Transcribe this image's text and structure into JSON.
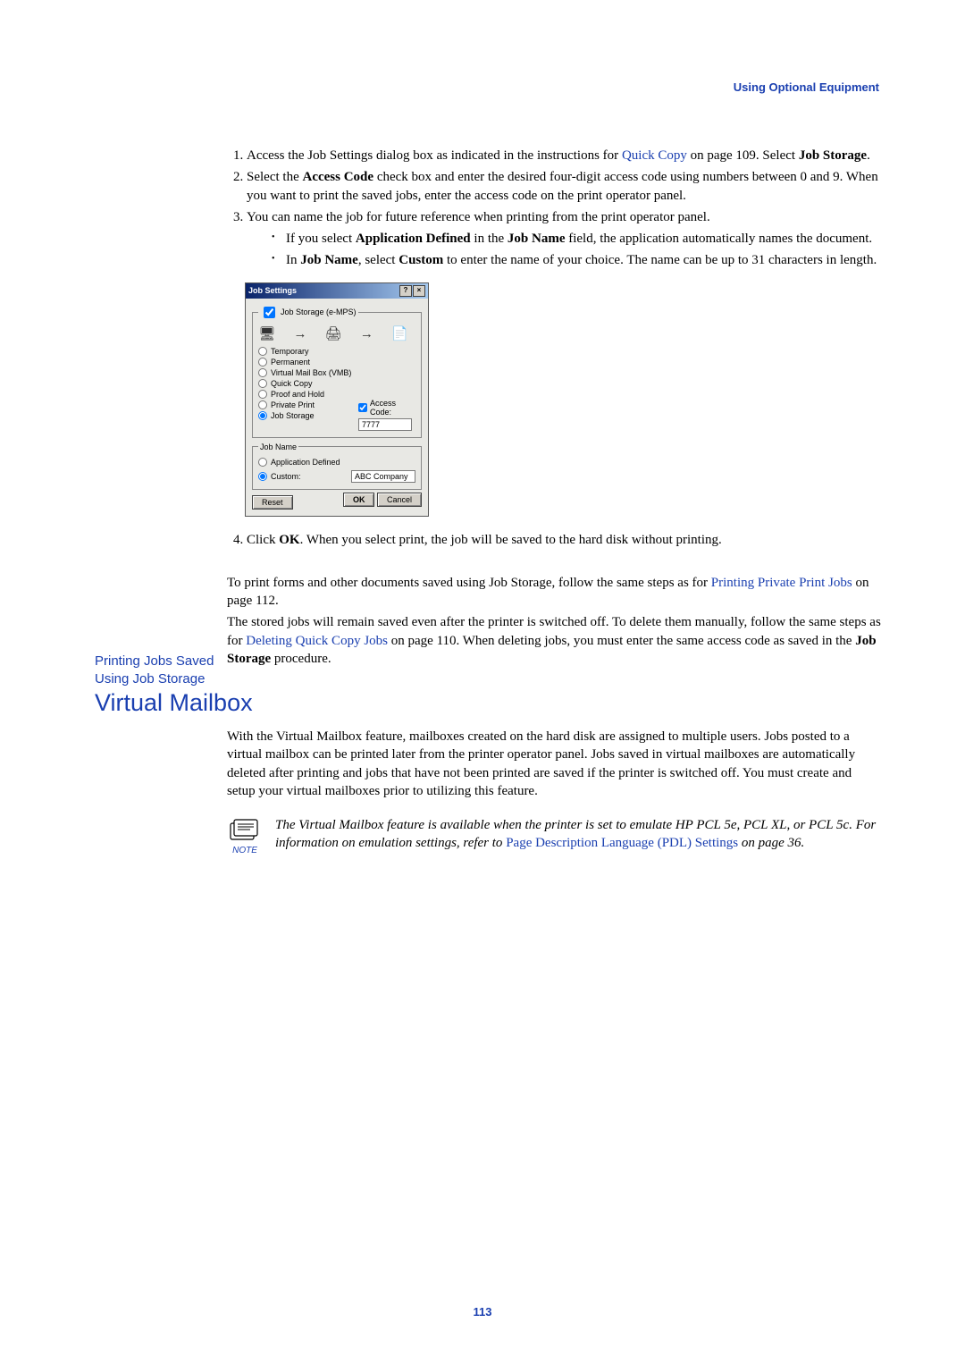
{
  "header": {
    "running": "Using Optional Equipment"
  },
  "steps": {
    "s1a": "Access the Job Settings dialog box as indicated in the instructions for ",
    "s1link": "Quick Copy",
    "s1b": " on page 109. Select ",
    "s1bold": "Job Storage",
    "s1c": ".",
    "s2a": "Select the ",
    "s2bold": "Access Code",
    "s2b": " check box and enter the desired four-digit access code using numbers between 0 and 9. When you want to print the saved jobs, enter the access code on the print operator panel.",
    "s3": "You can name the job for future reference when printing from the print operator panel.",
    "b1a": "If you select ",
    "b1bold1": "Application Defined",
    "b1b": " in the ",
    "b1bold2": "Job Name",
    "b1c": " field, the application automatically names the document.",
    "b2a": "In ",
    "b2bold1": "Job Name",
    "b2b": ", select ",
    "b2bold2": "Custom",
    "b2c": " to enter the name of your choice. The name can be up to 31 characters in length.",
    "s4a": "Click ",
    "s4bold": "OK",
    "s4b": ". When you select print, the job will be saved to the hard disk without printing."
  },
  "dialog": {
    "title": "Job Settings",
    "help": "?",
    "close": "×",
    "jobstorage_cb": "Job Storage (e-MPS)",
    "temp": "Temporary",
    "perm": "Permanent",
    "vmb": "Virtual Mail Box (VMB)",
    "quick": "Quick Copy",
    "proof": "Proof and Hold",
    "private": "Private Print",
    "storage": "Job Storage",
    "access_label": "Access Code:",
    "access_value": "7777",
    "jobname_legend": "Job Name",
    "appdef": "Application Defined",
    "custom": "Custom:",
    "custom_value": "ABC Company",
    "reset": "Reset",
    "ok": "OK",
    "cancel": "Cancel"
  },
  "sideheading": "Printing Jobs Saved Using Job Storage",
  "para": {
    "p1a": "To print forms and other documents saved using Job Storage, follow the same steps as for ",
    "p1link": "Printing Private Print Jobs",
    "p1b": " on page 112.",
    "p2a": "The stored jobs will remain saved even after the printer is switched off. To delete them manually, follow the same steps as for ",
    "p2link": "Deleting Quick Copy Jobs",
    "p2b": " on page 110. When deleting jobs, you must enter the same access code as saved in the ",
    "p2bold": "Job Storage",
    "p2c": " procedure."
  },
  "vmb": {
    "title": "Virtual Mailbox",
    "body": "With the Virtual Mailbox feature, mailboxes created on the hard disk are assigned to multiple users. Jobs posted to a virtual mailbox can be printed later from the printer operator panel. Jobs saved in virtual mailboxes are automatically deleted after printing and jobs that have not been printed are saved if the printer is switched off. You must create and setup your virtual mailboxes prior to utilizing this feature."
  },
  "note": {
    "label": "NOTE",
    "t1": "The Virtual Mailbox feature is available when the printer is set to emulate HP PCL 5e, PCL XL, or PCL 5c. For information on emulation settings, refer to ",
    "link": "Page Description Language (PDL) Settings",
    "t2": " on page 36."
  },
  "pagenum": "113"
}
